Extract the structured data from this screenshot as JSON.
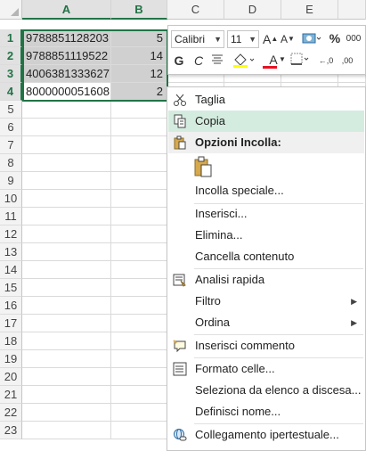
{
  "columns": [
    {
      "id": "A",
      "label": "A",
      "selected": true
    },
    {
      "id": "B",
      "label": "B",
      "selected": true
    },
    {
      "id": "C",
      "label": "C",
      "selected": false
    },
    {
      "id": "D",
      "label": "D",
      "selected": false
    },
    {
      "id": "E",
      "label": "E",
      "selected": false
    }
  ],
  "rows": [
    "1",
    "2",
    "3",
    "4",
    "5",
    "6",
    "7",
    "8",
    "9",
    "10",
    "11",
    "12",
    "13",
    "14",
    "15",
    "16",
    "17",
    "18",
    "19",
    "20",
    "21",
    "22",
    "23"
  ],
  "data": [
    {
      "a": "9788851128203",
      "b": "5"
    },
    {
      "a": "9788851119522",
      "b": "14"
    },
    {
      "a": "4006381333627",
      "b": "12"
    },
    {
      "a": "8000000051608",
      "b": "2"
    }
  ],
  "selection_color": "#217346",
  "mini_toolbar": {
    "font": "Calibri",
    "size": "11",
    "grow_font": "A",
    "shrink_font": "A",
    "percent": "%",
    "thousands": "000",
    "bold": "G",
    "italic": "C",
    "font_color_letter": "A",
    "dec_increase": "←,0",
    "dec_decrease": ",00"
  },
  "menu": {
    "items": [
      {
        "key": "taglia",
        "label": "Taglia",
        "icon": "scissors-icon"
      },
      {
        "key": "copia",
        "label": "Copia",
        "icon": "copy-icon"
      },
      {
        "key": "opzioni",
        "label": "Opzioni Incolla:",
        "icon": "paste-icon"
      },
      {
        "key": "incolla_speciale",
        "label": "Incolla speciale..."
      },
      {
        "key": "inserisci",
        "label": "Inserisci..."
      },
      {
        "key": "elimina",
        "label": "Elimina..."
      },
      {
        "key": "cancella",
        "label": "Cancella contenuto"
      },
      {
        "key": "analisi",
        "label": "Analisi rapida",
        "icon": "quick-analysis-icon"
      },
      {
        "key": "filtro",
        "label": "Filtro"
      },
      {
        "key": "ordina",
        "label": "Ordina"
      },
      {
        "key": "commento",
        "label": "Inserisci commento",
        "icon": "comment-icon"
      },
      {
        "key": "formato",
        "label": "Formato celle...",
        "icon": "format-cells-icon"
      },
      {
        "key": "seleziona",
        "label": "Seleziona da elenco a discesa..."
      },
      {
        "key": "definisci",
        "label": "Definisci nome..."
      },
      {
        "key": "collegamento",
        "label": "Collegamento ipertestuale...",
        "icon": "hyperlink-icon"
      }
    ],
    "highlighted": "copia",
    "highlight_color": "#d4ecdf"
  }
}
